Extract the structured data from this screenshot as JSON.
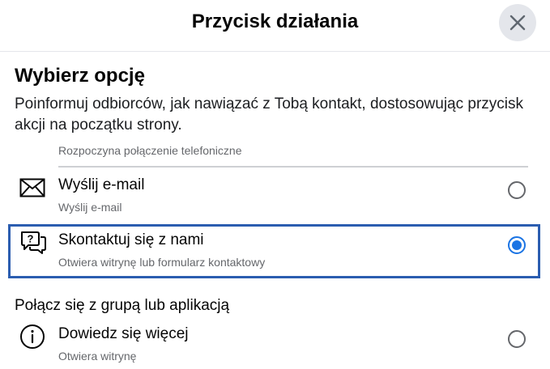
{
  "dialog": {
    "title": "Przycisk działania",
    "close_icon": "close-icon"
  },
  "section": {
    "title": "Wybierz opcję",
    "description": "Poinformuj odbiorców, jak nawiązać z Tobą kontakt, dostosowując przycisk akcji na początku strony."
  },
  "truncated_item": {
    "subtitle": "Rozpoczyna połączenie telefoniczne"
  },
  "options": [
    {
      "icon": "envelope-icon",
      "label": "Wyślij e-mail",
      "subtitle": "Wyślij e-mail",
      "selected": false
    },
    {
      "icon": "speech-bubble-question-icon",
      "label": "Skontaktuj się z nami",
      "subtitle": "Otwiera witrynę lub formularz kontaktowy",
      "selected": true
    }
  ],
  "group": {
    "title": "Połącz się z grupą lub aplikacją",
    "options": [
      {
        "icon": "info-circle-icon",
        "label": "Dowiedz się więcej",
        "subtitle": "Otwiera witrynę",
        "selected": false
      }
    ]
  },
  "colors": {
    "accent": "#1b74e4",
    "selection_border": "#2b5db0",
    "secondary_text": "#65676b",
    "close_button_bg": "#e4e6eb"
  }
}
